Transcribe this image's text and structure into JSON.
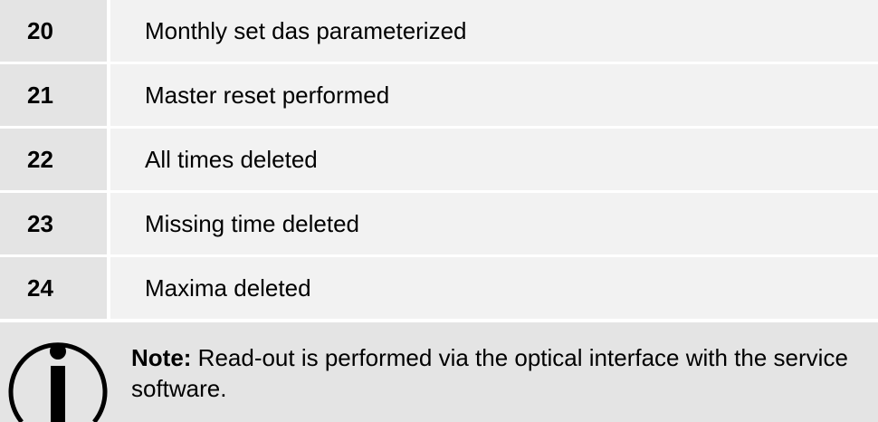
{
  "events": [
    {
      "code": "20",
      "description": "Monthly set das parameterized"
    },
    {
      "code": "21",
      "description": "Master reset performed"
    },
    {
      "code": "22",
      "description": "All times deleted"
    },
    {
      "code": "23",
      "description": "Missing time deleted"
    },
    {
      "code": "24",
      "description": "Maxima deleted"
    }
  ],
  "note": {
    "label": "Note:",
    "text": " Read-out is performed via the optical interface with the service software.",
    "icon": "info-icon"
  },
  "colors": {
    "code_cell": "#e4e4e4",
    "desc_cell": "#f2f2f2",
    "note_bg": "#e4e4e4",
    "text": "#000000"
  }
}
